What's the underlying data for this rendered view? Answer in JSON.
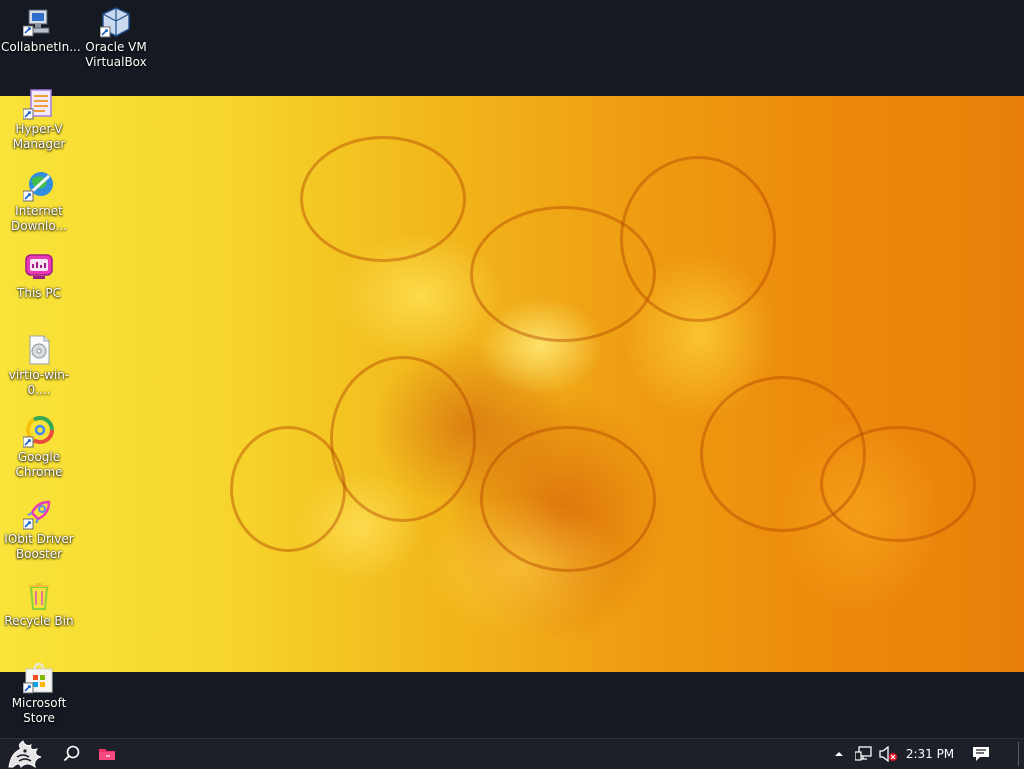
{
  "desktop": {
    "icons": [
      {
        "id": "collabnet",
        "label": "CollabnetIn...",
        "icon": "installer-computer-icon"
      },
      {
        "id": "virtualbox",
        "label": "Oracle VM VirtualBox",
        "icon": "virtualbox-cube-icon"
      },
      {
        "id": "hyperv",
        "label": "Hyper-V Manager",
        "icon": "hyperv-manager-icon"
      },
      {
        "id": "idm",
        "label": "Internet Downlo...",
        "icon": "globe-download-icon"
      },
      {
        "id": "thispc",
        "label": "This PC",
        "icon": "computer-monitor-icon"
      },
      {
        "id": "virtio",
        "label": "virtio-win-0....",
        "icon": "disc-image-file-icon"
      },
      {
        "id": "chrome",
        "label": "Google Chrome",
        "icon": "chrome-icon"
      },
      {
        "id": "iobit",
        "label": "IObit Driver Booster",
        "icon": "rocket-icon"
      },
      {
        "id": "recycle",
        "label": "Recycle Bin",
        "icon": "recycle-bin-icon"
      },
      {
        "id": "store",
        "label": "Microsoft Store",
        "icon": "store-bag-icon"
      }
    ]
  },
  "taskbar": {
    "start_icon": "dragon-start-icon",
    "search_icon": "search-icon",
    "pinned_icon": "file-explorer-folder-icon",
    "tray": {
      "overflow_icon": "chevron-up-icon",
      "network_icon": "network-icon",
      "volume_icon": "volume-muted-icon",
      "time": "2:31 PM",
      "notification_icon": "action-center-icon"
    }
  },
  "colors": {
    "taskbar_bg": "#1d2028",
    "desktop_bg": "#151a22",
    "wallpaper_yellow": "#f9e43a",
    "wallpaper_orange": "#e8800a",
    "mute_red": "#e81123"
  }
}
